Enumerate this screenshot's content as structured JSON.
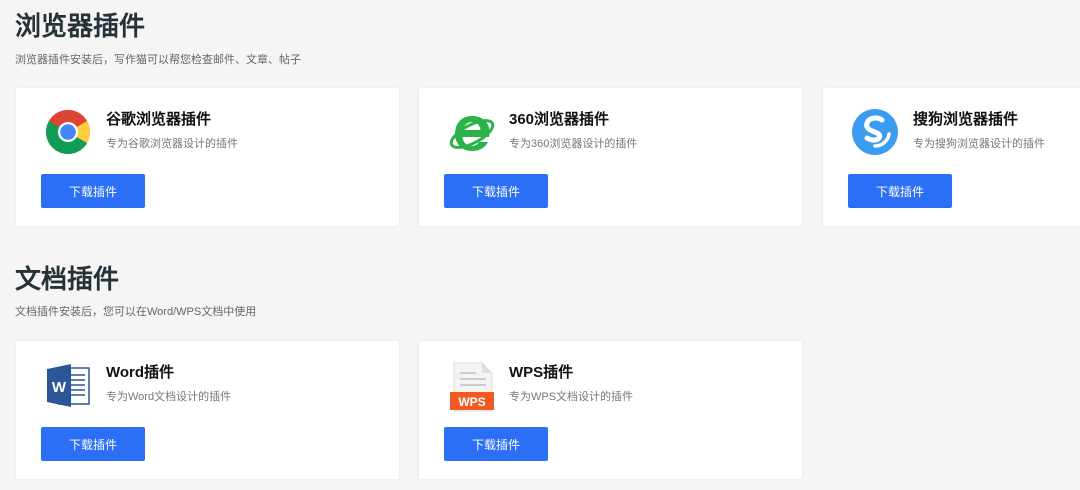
{
  "browser_section": {
    "title": "浏览器插件",
    "desc": "浏览器插件安装后，写作猫可以帮您检查邮件、文章、帖子",
    "cards": [
      {
        "name": "谷歌浏览器插件",
        "desc": "专为谷歌浏览器设计的插件",
        "button": "下载插件",
        "icon": "chrome-icon"
      },
      {
        "name": "360浏览器插件",
        "desc": "专为360浏览器设计的插件",
        "button": "下载插件",
        "icon": "360-browser-icon"
      },
      {
        "name": "搜狗浏览器插件",
        "desc": "专为搜狗浏览器设计的插件",
        "button": "下载插件",
        "icon": "sogou-browser-icon"
      }
    ]
  },
  "doc_section": {
    "title": "文档插件",
    "desc": "文档插件安装后，您可以在Word/WPS文档中使用",
    "cards": [
      {
        "name": "Word插件",
        "desc": "专为Word文档设计的插件",
        "button": "下载插件",
        "icon": "word-icon",
        "icon_letter": "W"
      },
      {
        "name": "WPS插件",
        "desc": "专为WPS文档设计的插件",
        "button": "下载插件",
        "icon": "wps-icon",
        "icon_label": "WPS"
      }
    ]
  },
  "colors": {
    "background": "#f5f5f5",
    "card": "#ffffff",
    "button": "#2a6ff6",
    "title": "#263238"
  }
}
